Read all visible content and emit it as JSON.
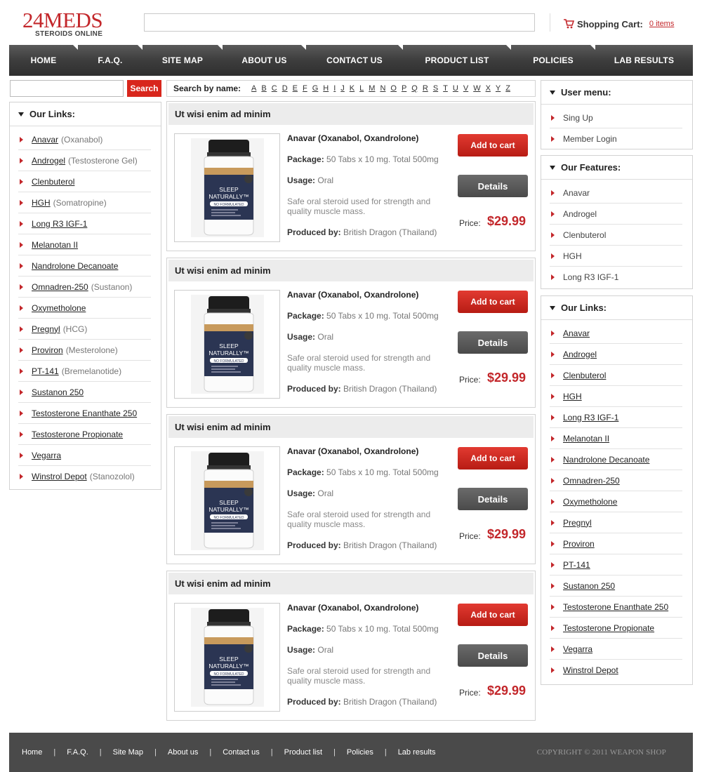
{
  "header": {
    "logo_main": "24MEDS",
    "logo_sub": "STEROIDS ONLINE",
    "cart_label": "Shopping Cart:",
    "cart_items": "0 items"
  },
  "nav": [
    "HOME",
    "F.A.Q.",
    "SITE MAP",
    "ABOUT US",
    "CONTACT US",
    "PRODUCT LIST",
    "POLICIES",
    "LAB RESULTS"
  ],
  "sidebar_left": {
    "search_button": "Search",
    "title": "Our Links:",
    "links": [
      {
        "name": "Anavar ",
        "sub": "(Oxanabol)"
      },
      {
        "name": "Androgel ",
        "sub": "(Testosterone Gel)"
      },
      {
        "name": "Clenbuterol",
        "sub": ""
      },
      {
        "name": "HGH ",
        "sub": "(Somatropine)"
      },
      {
        "name": "Long R3 IGF-1",
        "sub": ""
      },
      {
        "name": "Melanotan II",
        "sub": ""
      },
      {
        "name": "Nandrolone Decanoate",
        "sub": ""
      },
      {
        "name": "Omnadren-250 ",
        "sub": "(Sustanon)"
      },
      {
        "name": "Oxymetholone",
        "sub": ""
      },
      {
        "name": "Pregnyl ",
        "sub": "(HCG)"
      },
      {
        "name": "Proviron ",
        "sub": "(Mesterolone)"
      },
      {
        "name": "PT-141 ",
        "sub": "(Bremelanotide)"
      },
      {
        "name": "Sustanon 250",
        "sub": ""
      },
      {
        "name": "Testosterone Enanthate 250",
        "sub": ""
      },
      {
        "name": "Testosterone Propionate",
        "sub": ""
      },
      {
        "name": "Vegarra",
        "sub": ""
      },
      {
        "name": "Winstrol Depot ",
        "sub": "(Stanozolol)"
      }
    ]
  },
  "search_by_name": {
    "label": "Search by name:",
    "letters": [
      "A",
      "B",
      "C",
      "D",
      "E",
      "F",
      "G",
      "H",
      "I",
      "J",
      "K",
      "L",
      "M",
      "N",
      "O",
      "P",
      "Q",
      "R",
      "S",
      "T",
      "U",
      "V",
      "W",
      "X",
      "Y",
      "Z"
    ]
  },
  "products": [
    {
      "heading": "Ut wisi enim ad minim",
      "name": "Anavar (Oxanabol, Oxandrolone)",
      "package_label": "Package:",
      "package": "50 Tabs x 10 mg. Total 500mg",
      "usage_label": "Usage:",
      "usage": "Oral",
      "description": "Safe oral steroid used for strength and quality muscle mass.",
      "producer_label": "Produced by:",
      "producer": "British Dragon (Thailand)",
      "add_to_cart": "Add to cart",
      "details": "Details",
      "price_label": "Price:",
      "price": "$29.99",
      "bottle_brand": "SLEEP NATURALLY",
      "bottle_tag": "NO FORMULATED"
    },
    {
      "heading": "Ut wisi enim ad minim",
      "name": "Anavar (Oxanabol, Oxandrolone)",
      "package_label": "Package:",
      "package": "50 Tabs x 10 mg. Total 500mg",
      "usage_label": "Usage:",
      "usage": "Oral",
      "description": "Safe oral steroid used for strength and quality muscle mass.",
      "producer_label": "Produced by:",
      "producer": "British Dragon (Thailand)",
      "add_to_cart": "Add to cart",
      "details": "Details",
      "price_label": "Price:",
      "price": "$29.99",
      "bottle_brand": "SLEEP NATURALLY",
      "bottle_tag": "NO FORMULATED"
    },
    {
      "heading": "Ut wisi enim ad minim",
      "name": "Anavar (Oxanabol, Oxandrolone)",
      "package_label": "Package:",
      "package": "50 Tabs x 10 mg. Total 500mg",
      "usage_label": "Usage:",
      "usage": "Oral",
      "description": "Safe oral steroid used for strength and quality muscle mass.",
      "producer_label": "Produced by:",
      "producer": "British Dragon (Thailand)",
      "add_to_cart": "Add to cart",
      "details": "Details",
      "price_label": "Price:",
      "price": "$29.99",
      "bottle_brand": "SLEEP NATURALLY",
      "bottle_tag": "NO FORMULATED"
    },
    {
      "heading": "Ut wisi enim ad minim",
      "name": "Anavar (Oxanabol, Oxandrolone)",
      "package_label": "Package:",
      "package": "50 Tabs x 10 mg. Total 500mg",
      "usage_label": "Usage:",
      "usage": "Oral",
      "description": "Safe oral steroid used for strength and quality muscle mass.",
      "producer_label": "Produced by:",
      "producer": "British Dragon (Thailand)",
      "add_to_cart": "Add to cart",
      "details": "Details",
      "price_label": "Price:",
      "price": "$29.99",
      "bottle_brand": "SLEEP NATURALLY",
      "bottle_tag": "NO FORMULATED"
    }
  ],
  "sidebar_right": {
    "user_menu_title": "User menu:",
    "user_menu": [
      "Sing Up",
      "Member Login"
    ],
    "features_title": "Our Features:",
    "features": [
      "Anavar",
      "Androgel",
      "Clenbuterol",
      "HGH",
      "Long R3 IGF-1"
    ],
    "links_title": "Our Links:",
    "links": [
      "Anavar ",
      "Androgel ",
      "Clenbuterol",
      "HGH ",
      "Long R3 IGF-1",
      "Melanotan II",
      "Nandrolone Decanoate",
      "Omnadren-250 ",
      "Oxymetholone",
      "Pregnyl",
      "Proviron",
      "PT-141",
      "Sustanon 250",
      "Testosterone Enanthate 250",
      "Testosterone Propionate",
      "Vegarra",
      "Winstrol Depot "
    ]
  },
  "footer": {
    "links": [
      "Home",
      "F.A.Q.",
      "Site Map",
      "About us",
      "Contact us",
      "Product list",
      "Policies",
      "Lab results"
    ],
    "separator": "|",
    "copyright": "COPYRIGHT © 2011 WEAPON SHOP"
  },
  "colors": {
    "accent_red": "#c3272b",
    "nav_bg": "#3d3d3d",
    "footer_bg": "#4a4a4a"
  }
}
